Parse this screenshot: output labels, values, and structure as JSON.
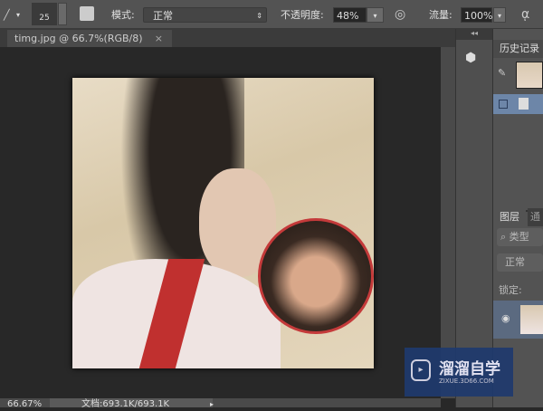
{
  "toolbar": {
    "brush_size": "25",
    "mode_label": "模式:",
    "mode_value": "正常",
    "opacity_label": "不透明度:",
    "opacity_value": "48%",
    "flow_label": "流量:",
    "flow_value": "100%"
  },
  "document_tab": {
    "title": "timg.jpg @ 66.7%(RGB/8)",
    "close": "×"
  },
  "history_panel": {
    "tab": "历史记录"
  },
  "layers_panel": {
    "tab": "图层",
    "tab2": "通",
    "filter": "类型",
    "blend_mode": "正常",
    "lock_label": "锁定:"
  },
  "status": {
    "zoom": "66.67%",
    "doc_info": "文档:693.1K/693.1K"
  },
  "watermark": {
    "name": "溜溜自学",
    "url": "ZIXUE.3D66.COM"
  },
  "colors": {
    "toolbar": "#535353",
    "canvas": "#282828",
    "watermark": "#1f3a6e"
  }
}
